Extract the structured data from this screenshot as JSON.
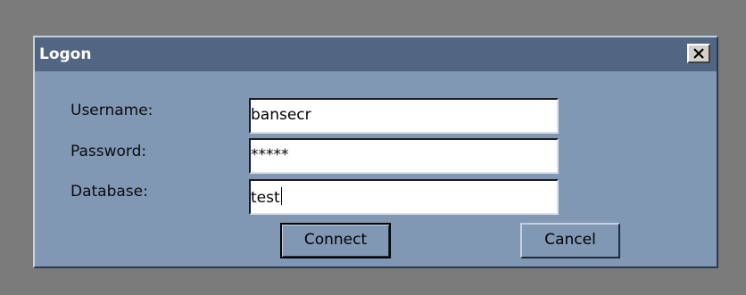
{
  "dialog": {
    "title": "Logon",
    "close_icon": "close-x-icon"
  },
  "form": {
    "username": {
      "label": "Username:",
      "value": "bansecr"
    },
    "password": {
      "label": "Password:",
      "value": "*****"
    },
    "database": {
      "label": "Database:",
      "value": "test"
    }
  },
  "buttons": {
    "connect": "Connect",
    "cancel": "Cancel"
  },
  "colors": {
    "desktop": "#7b7b7b",
    "dialog_body": "#8198b4",
    "titlebar": "#516682",
    "title_text": "#ffffff"
  }
}
